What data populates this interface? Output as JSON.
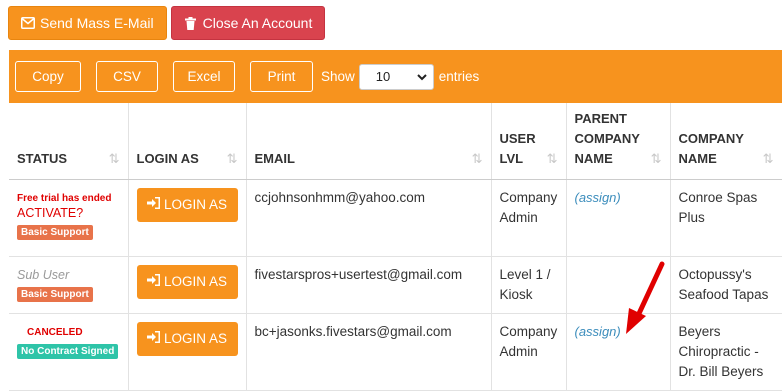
{
  "top_actions": {
    "send_mass_email": "Send Mass E-Mail",
    "close_account": "Close An Account"
  },
  "toolbar": {
    "copy": "Copy",
    "csv": "CSV",
    "excel": "Excel",
    "print": "Print",
    "show": "Show",
    "entries_value": "10",
    "entries": "entries"
  },
  "table": {
    "headers": {
      "status": "STATUS",
      "login_as": "LOGIN AS",
      "email": "EMAIL",
      "user_lvl": "USER LVL",
      "parent_company_name": "PARENT COMPANY NAME",
      "company_name": "COMPANY NAME"
    },
    "rows": [
      {
        "status_line1": "Free trial has ended",
        "status_link": "ACTIVATE?",
        "badge": "Basic Support",
        "login": "LOGIN AS",
        "email": "ccjohnsonhmm@yahoo.com",
        "user_lvl": "Company Admin",
        "parent": "(assign)",
        "company": "Conroe Spas Plus"
      },
      {
        "status_line1": "Sub User",
        "badge": "Basic Support",
        "login": "LOGIN AS",
        "email": "fivestarspros+usertest@gmail.com",
        "user_lvl": "Level 1 / Kiosk",
        "parent": "",
        "company": "Octopussy's Seafood Tapas"
      },
      {
        "status_line1": "CANCELED",
        "badge": "No Contract Signed",
        "login": "LOGIN AS",
        "email": "bc+jasonks.fivestars@gmail.com",
        "user_lvl": "Company Admin",
        "parent": "(assign)",
        "company": "Beyers Chiropractic - Dr. Bill Beyers"
      }
    ]
  },
  "colors": {
    "accent_orange": "#f7931e",
    "danger_red": "#d9434e",
    "link_blue": "#3c8dbc",
    "annotation_arrow": "#e00000"
  }
}
